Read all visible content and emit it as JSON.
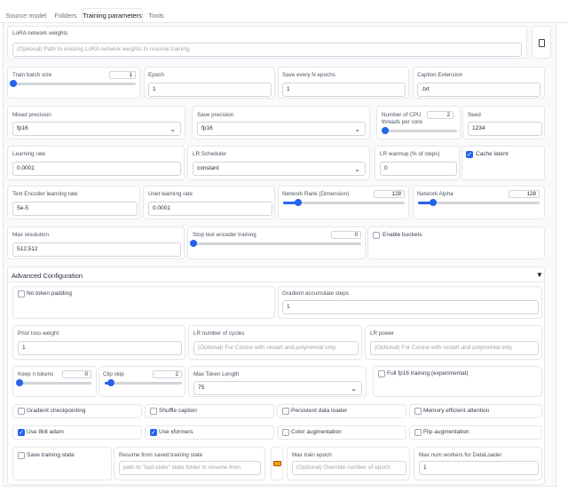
{
  "tabs": [
    "Source model",
    "Folders",
    "Training parameters",
    "Tools"
  ],
  "lora_weights": {
    "label": "LoRA network weights",
    "placeholder": "(Optional) Path to existing LoRA network weights to resume training"
  },
  "train_batch_size": {
    "label": "Train batch size",
    "value": "1",
    "progress": 0.0
  },
  "epoch": {
    "label": "Epoch",
    "value": "1"
  },
  "save_every": {
    "label": "Save every N epochs",
    "value": "1"
  },
  "caption_ext": {
    "label": "Caption Extension",
    "value": ".txt"
  },
  "mixed_precision": {
    "label": "Mixed precision",
    "value": "fp16"
  },
  "save_precision": {
    "label": "Save precision",
    "value": "fp16"
  },
  "cpu_threads": {
    "label_line1": "Number of CPU",
    "label_line2": "threads per core",
    "value": "2",
    "progress": 0.0
  },
  "seed": {
    "label": "Seed",
    "value": "1234"
  },
  "learning_rate": {
    "label": "Learning rate",
    "value": "0.0001"
  },
  "lr_scheduler": {
    "label": "LR Scheduler",
    "value": "constant"
  },
  "lr_warmup": {
    "label": "LR warmup (% of steps)",
    "value": "0"
  },
  "cache_latent": {
    "label": "Cache latent",
    "checked": true
  },
  "text_encoder_lr": {
    "label": "Text Encoder learning rate",
    "value": "5e-5"
  },
  "unet_lr": {
    "label": "Unet learning rate",
    "value": "0.0001"
  },
  "network_rank": {
    "label": "Network Rank (Dimension)",
    "value": "128",
    "progress": 0.125
  },
  "network_alpha": {
    "label": "Network Alpha",
    "value": "128",
    "progress": 0.125
  },
  "max_resolution": {
    "label": "Max resolution",
    "value": "512,512"
  },
  "stop_text_encoder": {
    "label": "Stop text encoder training",
    "value": "0",
    "progress": 0.0
  },
  "enable_buckets": {
    "label": "Enable buckets",
    "checked": false
  },
  "advanced": {
    "title": "Advanced Configuration",
    "no_token_padding": "No token padding",
    "gradient_accum": {
      "label": "Gradient accumulate steps",
      "value": "1"
    },
    "prior_loss": {
      "label": "Prior loss weight",
      "value": "1"
    },
    "lr_cycles": {
      "label": "LR number of cycles",
      "placeholder": "(Optional) For Cosine with restart and polynomial only"
    },
    "lr_power": {
      "label": "LR power",
      "placeholder": "(Optional) For Cosine with restart and polynomial only"
    },
    "keep_tokens": {
      "label": "Keep n tokens",
      "value": "0",
      "progress": 0.0
    },
    "clip_skip": {
      "label": "Clip skip",
      "value": "2",
      "progress": 0.08
    },
    "max_token_length": {
      "label": "Max Token Length",
      "value": "75"
    },
    "full_fp16": "Full fp16 training (experimental)",
    "row1": [
      "Gradient checkpointing",
      "Shuffle caption",
      "Persistent data loader",
      "Memory efficient attention"
    ],
    "row2": [
      "Use 8bit adam",
      "Use xformers",
      "Color augmentation",
      "Flip augmentation"
    ],
    "save_state": "Save training state",
    "resume": {
      "label": "Resume from saved training state",
      "placeholder": "path to \"last-state\" state folder to resume from"
    },
    "folder_icon": "folder-icon",
    "max_train_epoch": {
      "label": "Max train epoch",
      "placeholder": "(Optional) Override number of epoch"
    },
    "max_workers": {
      "label": "Max num workers for DataLoader",
      "value": "1"
    }
  },
  "colors": {
    "accent": "#2563eb",
    "border": "#e5e7eb"
  }
}
